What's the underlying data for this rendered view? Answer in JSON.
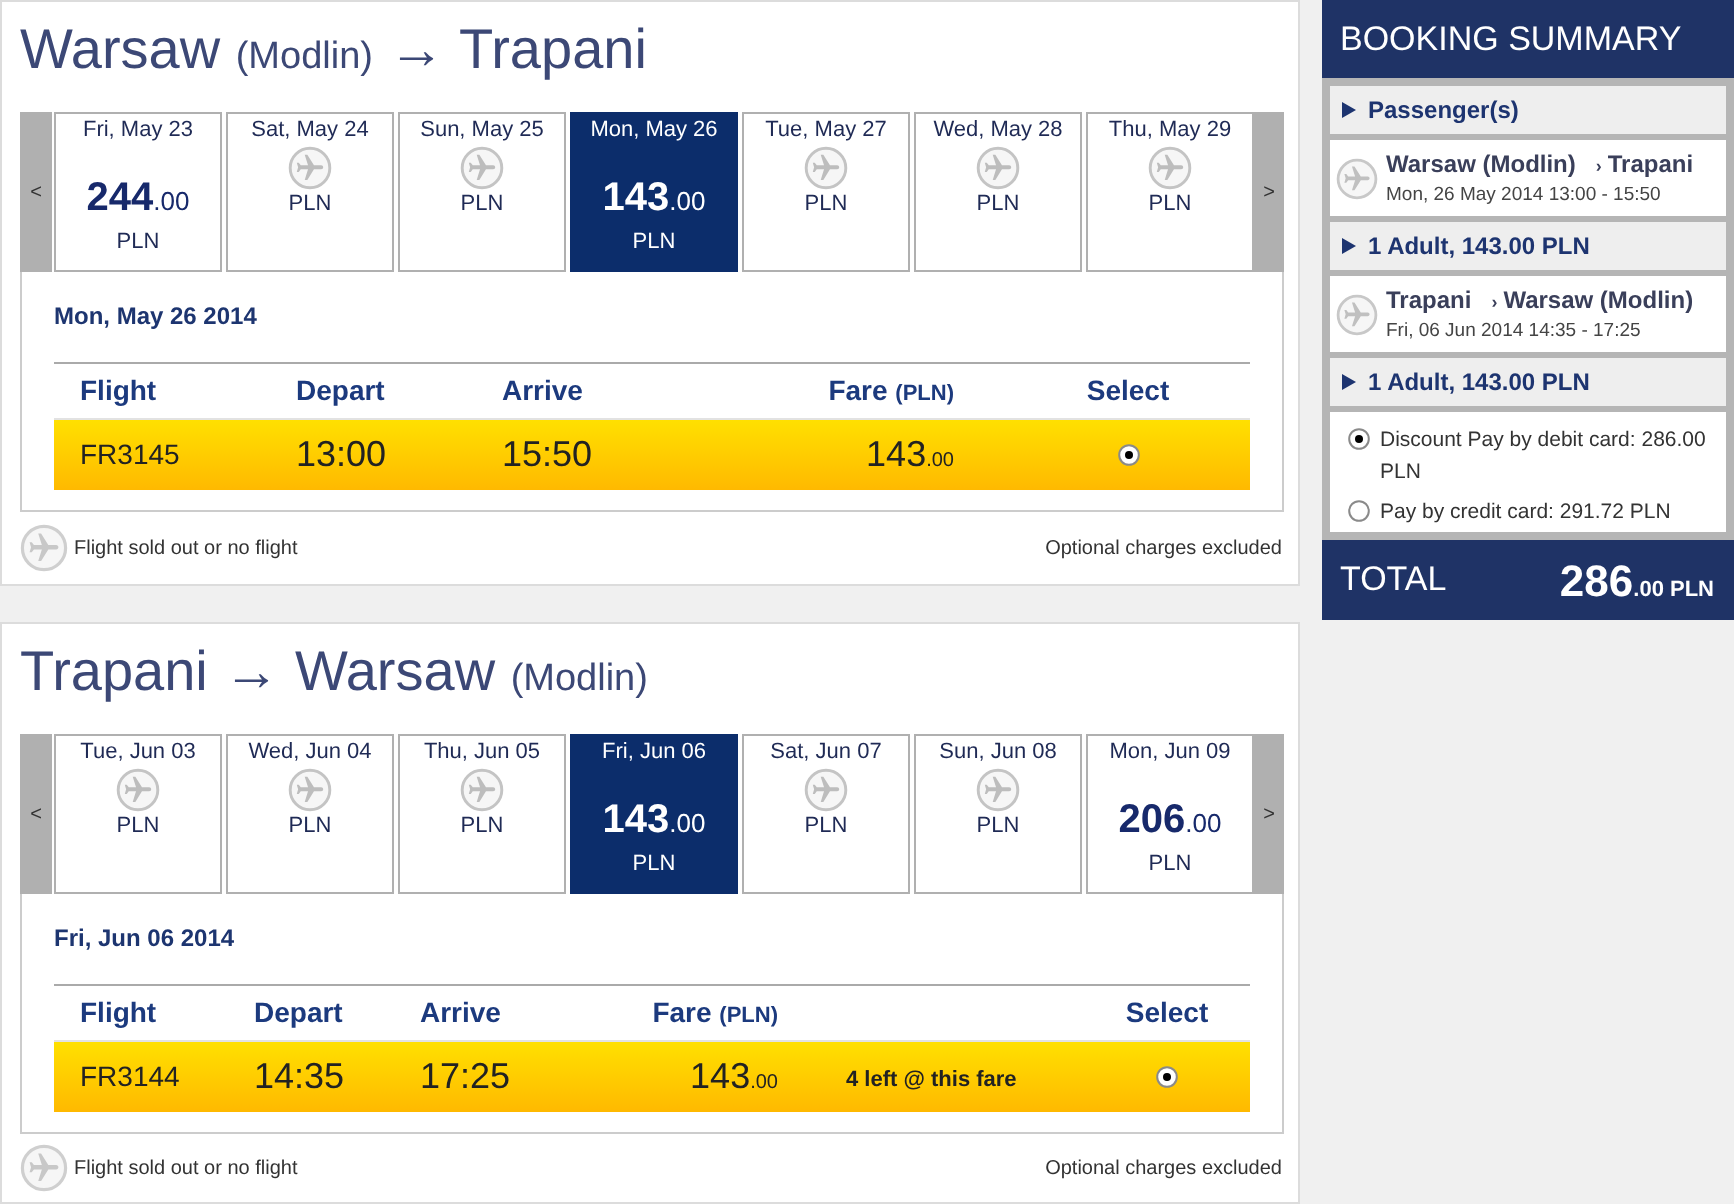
{
  "flights": [
    {
      "title": [
        {
          "kind": "city",
          "text": "Warsaw"
        },
        {
          "kind": "airport",
          "text": "(Modlin)"
        },
        {
          "kind": "arrow",
          "text": "→"
        },
        {
          "kind": "city",
          "text": "Trapani"
        }
      ],
      "prev": "<",
      "next": ">",
      "days": [
        {
          "day": "Fri, May 23",
          "available": true,
          "price": "244",
          "decimals": ".00",
          "currency": "PLN",
          "selected": false
        },
        {
          "day": "Sat, May 24",
          "available": false,
          "currency": "PLN",
          "selected": false
        },
        {
          "day": "Sun, May 25",
          "available": false,
          "currency": "PLN",
          "selected": false
        },
        {
          "day": "Mon, May 26",
          "available": true,
          "price": "143",
          "decimals": ".00",
          "currency": "PLN",
          "selected": true
        },
        {
          "day": "Tue, May 27",
          "available": false,
          "currency": "PLN",
          "selected": false
        },
        {
          "day": "Wed, May 28",
          "available": false,
          "currency": "PLN",
          "selected": false
        },
        {
          "day": "Thu, May 29",
          "available": false,
          "currency": "PLN",
          "selected": false
        }
      ],
      "date": "Mon, May 26 2014",
      "columns": [
        {
          "label": "Flight"
        },
        {
          "label": "Depart"
        },
        {
          "label": "Arrive"
        },
        {
          "label": "Fare",
          "unit": "(PLN)"
        },
        {
          "label": "Select"
        }
      ],
      "rows": [
        {
          "flight": "FR3145",
          "depart": "13:00",
          "arrive": "15:50",
          "fare": "143",
          "decimals": ".00",
          "selected": true
        }
      ],
      "legend": "Flight sold out or no flight",
      "note": "Optional charges excluded"
    },
    {
      "title": [
        {
          "kind": "city",
          "text": "Trapani"
        },
        {
          "kind": "arrow",
          "text": "→"
        },
        {
          "kind": "city",
          "text": "Warsaw"
        },
        {
          "kind": "airport",
          "text": "(Modlin)"
        }
      ],
      "prev": "<",
      "next": ">",
      "days": [
        {
          "day": "Tue, Jun 03",
          "available": false,
          "currency": "PLN",
          "selected": false
        },
        {
          "day": "Wed, Jun 04",
          "available": false,
          "currency": "PLN",
          "selected": false
        },
        {
          "day": "Thu, Jun 05",
          "available": false,
          "currency": "PLN",
          "selected": false
        },
        {
          "day": "Fri, Jun 06",
          "available": true,
          "price": "143",
          "decimals": ".00",
          "currency": "PLN",
          "selected": true
        },
        {
          "day": "Sat, Jun 07",
          "available": false,
          "currency": "PLN",
          "selected": false
        },
        {
          "day": "Sun, Jun 08",
          "available": false,
          "currency": "PLN",
          "selected": false
        },
        {
          "day": "Mon, Jun 09",
          "available": true,
          "price": "206",
          "decimals": ".00",
          "currency": "PLN",
          "selected": false
        }
      ],
      "date": "Fri, Jun 06 2014",
      "columns": [
        {
          "label": "Flight"
        },
        {
          "label": "Depart"
        },
        {
          "label": "Arrive"
        },
        {
          "label": "Fare",
          "unit": "(PLN)"
        },
        {
          "label": "Select"
        }
      ],
      "rows": [
        {
          "flight": "FR3144",
          "depart": "14:35",
          "arrive": "17:25",
          "fare": "143",
          "decimals": ".00",
          "seats_note": "4 left @ this fare",
          "selected": true
        }
      ],
      "legend": "Flight sold out or no flight",
      "note": "Optional charges excluded"
    }
  ],
  "summary": {
    "title": "BOOKING SUMMARY",
    "items": [
      {
        "kind": "toggle",
        "label": "Passenger(s)",
        "expanded": false
      },
      {
        "kind": "flight",
        "route": {
          "from": "Warsaw (Modlin)",
          "separator": "›",
          "to": "Trapani"
        },
        "time": "Mon, 26 May 2014 13:00 - 15:50"
      },
      {
        "kind": "toggle",
        "label": "1 Adult, 143.00 PLN",
        "expanded": false
      },
      {
        "kind": "flight",
        "route": {
          "from": "Trapani",
          "separator": "›",
          "to": "Warsaw (Modlin)"
        },
        "time": "Fri, 06 Jun 2014 14:35 - 17:25"
      },
      {
        "kind": "toggle",
        "label": "1 Adult, 143.00 PLN",
        "expanded": false
      },
      {
        "kind": "payment",
        "options": [
          {
            "label": "Discount Pay by debit card: 286.00 PLN",
            "selected": true
          },
          {
            "label": "Pay by credit card: 291.72 PLN",
            "selected": false
          }
        ]
      }
    ],
    "total": {
      "label": "TOTAL",
      "amount": "286",
      "decimals": ".00",
      "currency": "PLN"
    }
  }
}
